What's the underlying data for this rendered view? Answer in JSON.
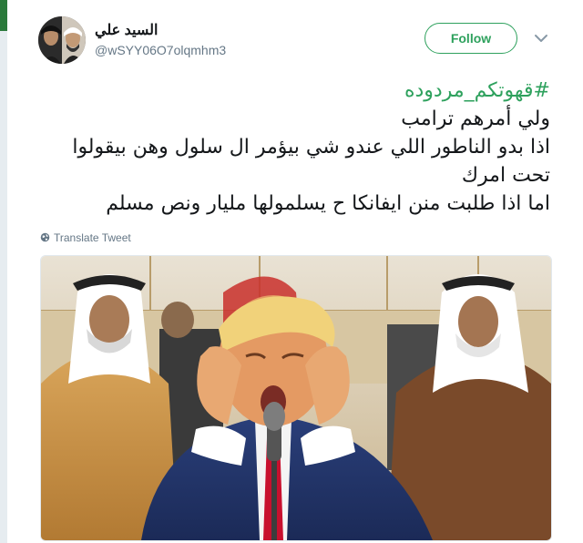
{
  "user": {
    "display_name": "السيد علي",
    "username": "@wSYY06O7olqmhm3"
  },
  "follow_label": "Follow",
  "tweet": {
    "hashtag": "#قهوتكم_مردوده",
    "lines": [
      "ولي أمرهم ترامب",
      "اذا بدو الناطور اللي عندو شي بيؤمر ال سلول وهن بيقولوا",
      "تحت امرك",
      "اما اذا طلبت منن ايفانكا ح يسلمولها مليار ونص مسلم"
    ]
  },
  "translate_label": "Translate Tweet",
  "icons": {
    "menu": "chevron-down-icon",
    "translate": "globe-icon"
  },
  "colors": {
    "accent": "#2ea15d",
    "secondary_text": "#657786",
    "text": "#14171a"
  }
}
